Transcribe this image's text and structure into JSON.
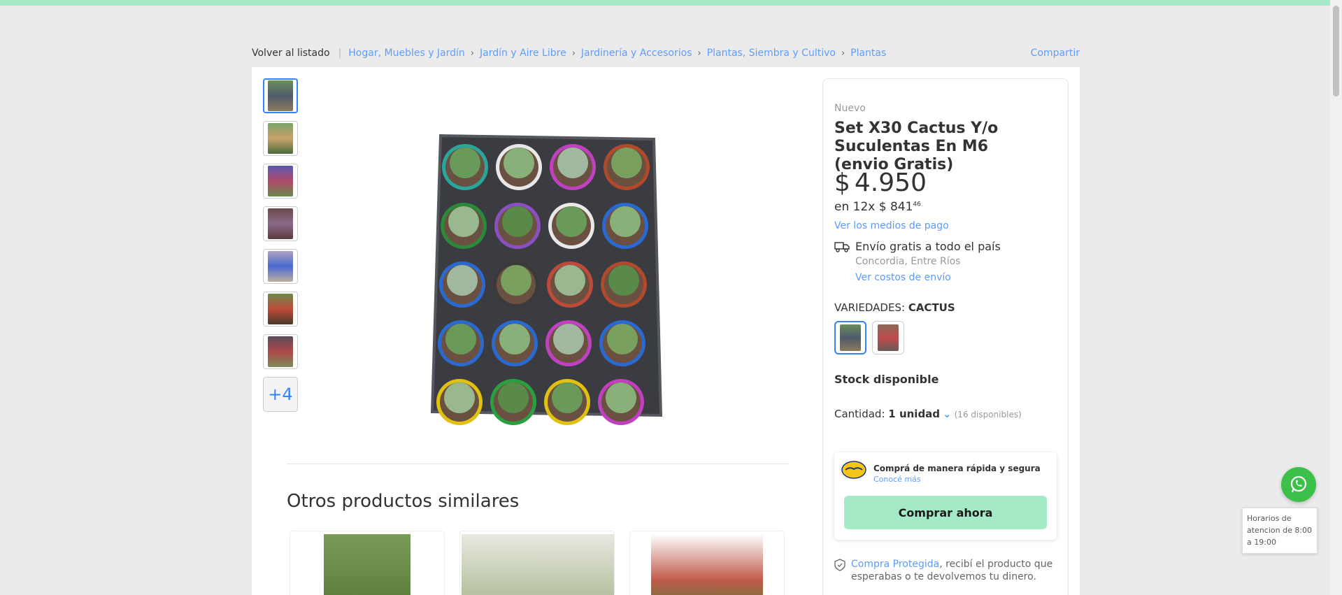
{
  "breadcrumb": {
    "back_label": "Volver al listado",
    "separator": "|",
    "items": [
      "Hogar, Muebles y Jardín",
      "Jardín y Aire Libre",
      "Jardinería y Accesorios",
      "Plantas, Siembra y Cultivo",
      "Plantas"
    ],
    "share_label": "Compartir"
  },
  "gallery": {
    "more_label": "+4"
  },
  "product": {
    "condition": "Nuevo",
    "title": "Set X30 Cactus Y/o Suculentas En M6 (envio Gratis)",
    "price_currency": "$",
    "price": "4.950",
    "installments_prefix": "en 12x $ 841",
    "installments_cents": "46",
    "payment_link": "Ver los medios de pago"
  },
  "shipping": {
    "title": "Envío gratis a todo el país",
    "location": "Concordia, Entre Ríos",
    "costs_link": "Ver costos de envío"
  },
  "variants": {
    "label": "VARIEDADES: ",
    "selected": "CACTUS"
  },
  "stock": {
    "label": "Stock disponible",
    "qty_label": "Cantidad: ",
    "qty_value": "1 unidad",
    "qty_available": "(16 disponibles)"
  },
  "mercadopago": {
    "text": "Comprá de manera rápida y segura",
    "link": "Conocé más",
    "buy_label": "Comprar ahora"
  },
  "protected": {
    "link": "Compra Protegida",
    "text": ", recibí el producto que esperabas o te devolvemos tu dinero."
  },
  "similar": {
    "title": "Otros productos similares"
  },
  "whatsapp": {
    "hours": "Horarios de atencion de 8:00 a 19:00"
  },
  "colors": {
    "accent": "#3483fa",
    "buy_button": "#a5eac6",
    "whatsapp": "#3cc04a"
  }
}
